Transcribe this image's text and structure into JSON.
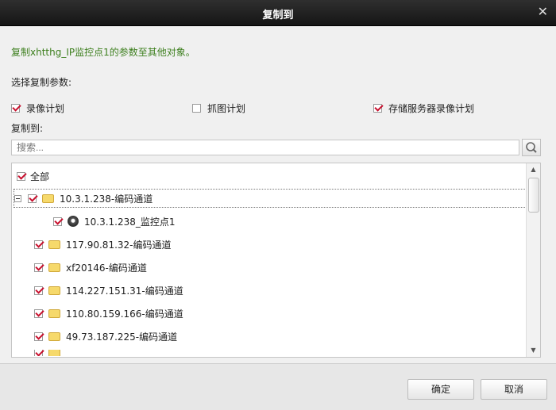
{
  "dialog": {
    "title": "复制到",
    "close_icon": "close-icon"
  },
  "info_text": "复制xhtthg_IP监控点1的参数至其他对象。",
  "select_params_label": "选择复制参数:",
  "options": [
    {
      "label": "录像计划",
      "checked": true
    },
    {
      "label": "抓图计划",
      "checked": false
    },
    {
      "label": "存储服务器录像计划",
      "checked": true
    }
  ],
  "copy_to_label": "复制到:",
  "search": {
    "placeholder": "搜索...",
    "icon": "search-icon"
  },
  "tree": {
    "root": {
      "label": "全部",
      "checked": true
    },
    "items": [
      {
        "label": "10.3.1.238-编码通道",
        "checked": true,
        "expanded": true,
        "icon": "folder-icon"
      },
      {
        "label": "10.3.1.238_监控点1",
        "checked": true,
        "child": true,
        "icon": "camera-icon"
      },
      {
        "label": "117.90.81.32-编码通道",
        "checked": true,
        "icon": "folder-icon"
      },
      {
        "label": "xf20146-编码通道",
        "checked": true,
        "icon": "folder-icon"
      },
      {
        "label": "114.227.151.31-编码通道",
        "checked": true,
        "icon": "folder-icon"
      },
      {
        "label": "110.80.159.166-编码通道",
        "checked": true,
        "icon": "folder-icon"
      },
      {
        "label": "49.73.187.225-编码通道",
        "checked": true,
        "icon": "folder-icon"
      }
    ]
  },
  "buttons": {
    "ok": "确定",
    "cancel": "取消"
  }
}
